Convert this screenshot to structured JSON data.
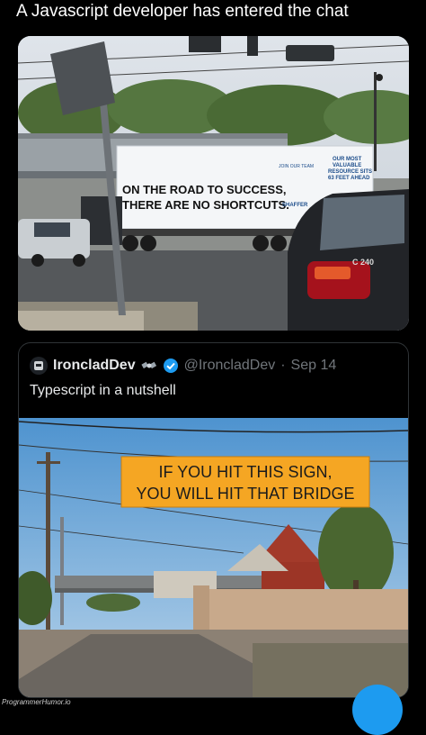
{
  "caption": "A Javascript developer has entered the chat",
  "photo1": {
    "truck_text_line1": "ON THE ROAD TO SUCCESS,",
    "truck_text_line2": "THERE ARE NO SHORTCUTS.",
    "truck_small_1": "JOIN OUR TEAM",
    "truck_small_2": "OUR MOST",
    "truck_small_3": "VALUABLE",
    "truck_small_4": "RESOURCE SITS",
    "truck_small_5": "63 FEET AHEAD",
    "truck_logo": "SHAFFER",
    "car_badge": "C 240"
  },
  "quote": {
    "name": "IroncladDev",
    "handle": "@IroncladDev",
    "separator": "·",
    "date": "Sep 14",
    "text": "Typescript in a nutshell"
  },
  "photo2": {
    "sign_line1": "IF YOU HIT THIS SIGN,",
    "sign_line2": "YOU WILL HIT THAT BRIDGE"
  },
  "watermark": "ProgrammerHumor.io",
  "colors": {
    "accent": "#1d9bf0",
    "sign": "#f5a623",
    "background": "#000000"
  }
}
